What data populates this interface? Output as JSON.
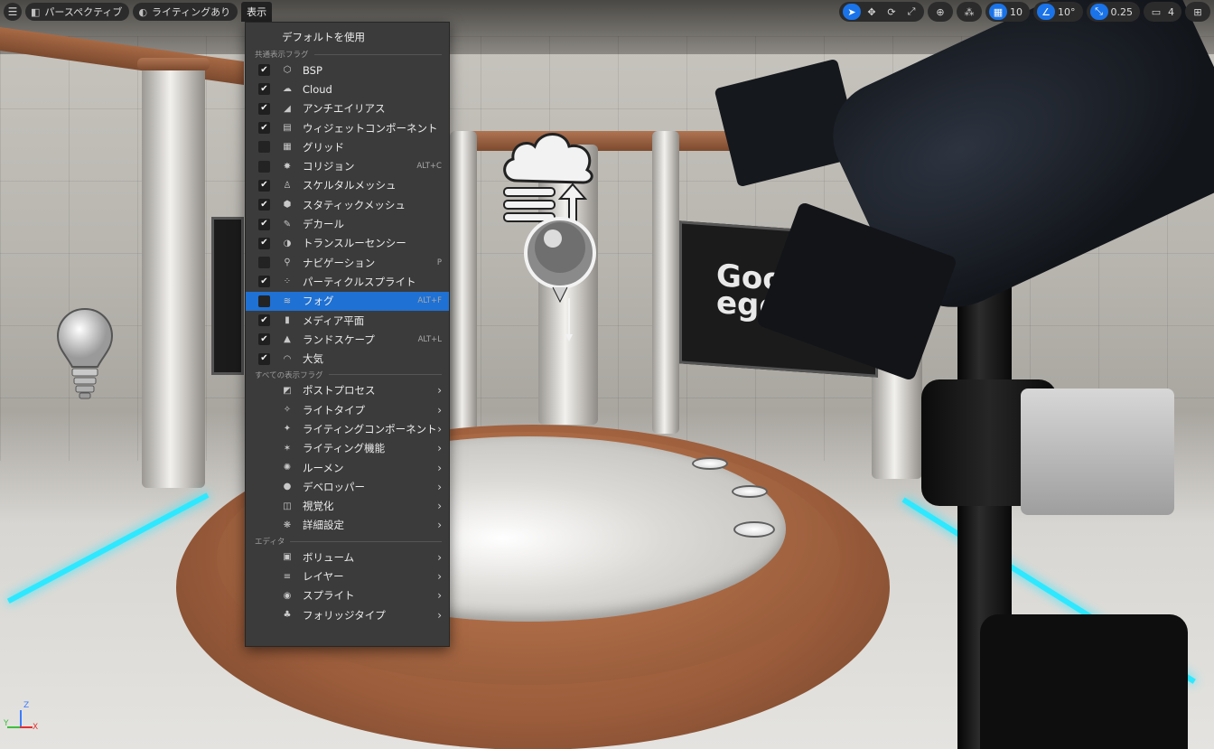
{
  "toolbar": {
    "menu_icon": "hamburger-icon",
    "perspective_label": "パースペクティブ",
    "lighting_label": "ライティングあり",
    "show_label": "表示",
    "grid_value": "10",
    "angle_value": "10°",
    "scale_value": "0.25",
    "camera_speed_value": "4"
  },
  "screen_text": "Good\negg",
  "menu": {
    "default_label": "デフォルトを使用",
    "common_flags_header": "共通表示フラグ",
    "all_flags_header": "すべての表示フラグ",
    "editor_header": "エディタ",
    "common_items": [
      {
        "label": "BSP",
        "checked": true,
        "shortcut": "",
        "icon": "bsp-icon"
      },
      {
        "label": "Cloud",
        "checked": true,
        "shortcut": "",
        "icon": "cloud-icon"
      },
      {
        "label": "アンチエイリアス",
        "checked": true,
        "shortcut": "",
        "icon": "antialias-icon"
      },
      {
        "label": "ウィジェットコンポーネント",
        "checked": true,
        "shortcut": "",
        "icon": "widget-icon"
      },
      {
        "label": "グリッド",
        "checked": false,
        "shortcut": "",
        "icon": "grid-icon"
      },
      {
        "label": "コリジョン",
        "checked": false,
        "shortcut": "ALT+C",
        "icon": "collision-icon"
      },
      {
        "label": "スケルタルメッシュ",
        "checked": true,
        "shortcut": "",
        "icon": "skeletal-mesh-icon"
      },
      {
        "label": "スタティックメッシュ",
        "checked": true,
        "shortcut": "",
        "icon": "static-mesh-icon"
      },
      {
        "label": "デカール",
        "checked": true,
        "shortcut": "",
        "icon": "decal-icon"
      },
      {
        "label": "トランスルーセンシー",
        "checked": true,
        "shortcut": "",
        "icon": "translucency-icon"
      },
      {
        "label": "ナビゲーション",
        "checked": false,
        "shortcut": "P",
        "icon": "navigation-icon"
      },
      {
        "label": "パーティクルスプライト",
        "checked": true,
        "shortcut": "",
        "icon": "particle-icon"
      },
      {
        "label": "フォグ",
        "checked": false,
        "shortcut": "ALT+F",
        "icon": "fog-icon",
        "highlighted": true
      },
      {
        "label": "メディア平面",
        "checked": true,
        "shortcut": "",
        "icon": "media-plane-icon"
      },
      {
        "label": "ランドスケープ",
        "checked": true,
        "shortcut": "ALT+L",
        "icon": "landscape-icon"
      },
      {
        "label": "大気",
        "checked": true,
        "shortcut": "",
        "icon": "atmosphere-icon"
      }
    ],
    "all_items": [
      {
        "label": "ポストプロセス",
        "icon": "post-process-icon"
      },
      {
        "label": "ライトタイプ",
        "icon": "light-type-icon"
      },
      {
        "label": "ライティングコンポーネント",
        "icon": "lighting-component-icon"
      },
      {
        "label": "ライティング機能",
        "icon": "lighting-feature-icon"
      },
      {
        "label": "ルーメン",
        "icon": "lumen-icon"
      },
      {
        "label": "デベロッパー",
        "icon": "developer-icon"
      },
      {
        "label": "視覚化",
        "icon": "visualize-icon"
      },
      {
        "label": "詳細設定",
        "icon": "advanced-icon"
      }
    ],
    "editor_items": [
      {
        "label": "ボリューム",
        "icon": "volume-icon"
      },
      {
        "label": "レイヤー",
        "icon": "layer-icon"
      },
      {
        "label": "スプライト",
        "icon": "sprite-icon"
      },
      {
        "label": "フォリッジタイプ",
        "icon": "foliage-icon"
      }
    ]
  },
  "gizmo": {
    "x": "X",
    "y": "Y",
    "z": "Z"
  },
  "colors": {
    "accent": "#1f71d4",
    "menu_bg": "#3b3b3b",
    "glow": "#2ee8ff"
  }
}
